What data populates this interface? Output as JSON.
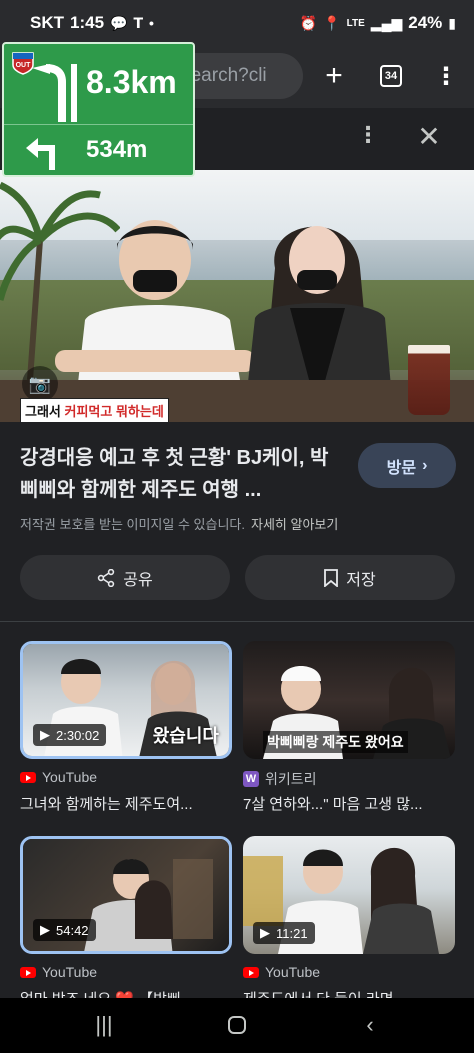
{
  "status_bar": {
    "carrier": "SKT",
    "time": "1:45",
    "battery": "24%",
    "network": "LTE"
  },
  "browser": {
    "url": "m/search?cli",
    "tab_count": "34"
  },
  "navigation_overlay": {
    "badge": "OUT",
    "distance_primary": "8.3km",
    "distance_secondary": "534m"
  },
  "image": {
    "caption_part1": "그래서 ",
    "caption_part2": "커피먹고 뭐하는데"
  },
  "result": {
    "title": "강경대응 예고 후 첫 근황' BJ케이, 박삐삐와 함께한 제주도 여행 ...",
    "visit_label": "방문",
    "copyright_note": "저작권 보호를 받는 이미지일 수 있습니다.",
    "learn_more": "자세히 알아보기",
    "share_label": "공유",
    "save_label": "저장"
  },
  "related": [
    {
      "duration": "2:30:02",
      "overlay_text": "왔습니다",
      "source": "YouTube",
      "title": "그녀와 함께하는 제주도여..."
    },
    {
      "duration": "",
      "overlay_text": "박삐삐랑 제주도 왔어요",
      "source": "위키트리",
      "title": "7살 연하와...\" 마음 고생 많..."
    },
    {
      "duration": "54:42",
      "overlay_text": "",
      "source": "YouTube",
      "title": "얼마 받죠 네요 ❤️ 【박삐"
    },
    {
      "duration": "11:21",
      "overlay_text": "",
      "source": "YouTube",
      "title": "제주도에서 단 둘이 라면"
    }
  ],
  "colors": {
    "background": "#202124",
    "nav_green": "#2e9a4a",
    "visit_button": "#394457",
    "youtube_red": "#ff0000"
  }
}
